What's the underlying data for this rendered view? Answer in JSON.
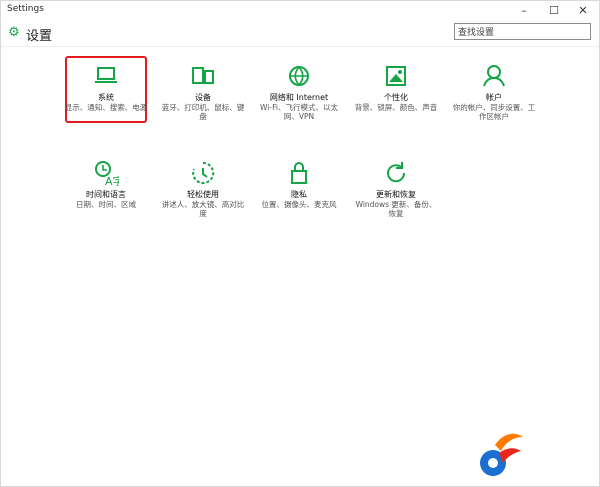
{
  "window": {
    "title": "Settings",
    "minimize": "–",
    "maximize": "☐",
    "close": "✕"
  },
  "header": {
    "app_title": "设置",
    "search_placeholder": "查找设置"
  },
  "tiles": [
    {
      "name": "系统",
      "desc": "显示、通知、搜索、电源",
      "icon": "laptop-icon"
    },
    {
      "name": "设备",
      "desc": "蓝牙、打印机、鼠标、键盘",
      "icon": "devices-icon"
    },
    {
      "name": "网络和 Internet",
      "desc": "Wi-Fi、飞行模式、以太网、VPN",
      "icon": "globe-icon"
    },
    {
      "name": "个性化",
      "desc": "背景、锁屏、颜色、声音",
      "icon": "personalization-icon"
    },
    {
      "name": "帐户",
      "desc": "你的帐户、同步设置、工作区帐户",
      "icon": "person-icon"
    },
    {
      "name": "时间和语言",
      "desc": "日期、时间、区域",
      "icon": "time-language-icon"
    },
    {
      "name": "轻松使用",
      "desc": "讲述人、放大镜、高对比度",
      "icon": "ease-of-access-icon"
    },
    {
      "name": "隐私",
      "desc": "位置、摄像头、麦克风",
      "icon": "lock-icon"
    },
    {
      "name": "更新和恢复",
      "desc": "Windows 更新、备份、恢复",
      "icon": "refresh-icon"
    }
  ],
  "accent_color": "#13a546",
  "selection_color": "#e31b1b"
}
